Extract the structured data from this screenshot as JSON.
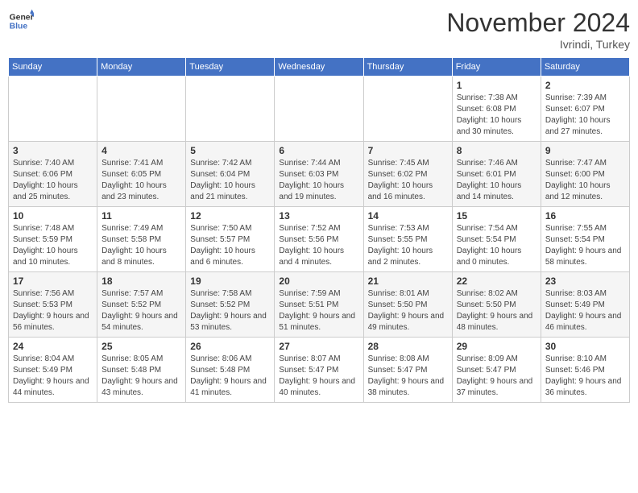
{
  "header": {
    "logo_line1": "General",
    "logo_line2": "Blue",
    "month": "November 2024",
    "location": "Ivrindi, Turkey"
  },
  "weekdays": [
    "Sunday",
    "Monday",
    "Tuesday",
    "Wednesday",
    "Thursday",
    "Friday",
    "Saturday"
  ],
  "weeks": [
    [
      {
        "day": "",
        "info": ""
      },
      {
        "day": "",
        "info": ""
      },
      {
        "day": "",
        "info": ""
      },
      {
        "day": "",
        "info": ""
      },
      {
        "day": "",
        "info": ""
      },
      {
        "day": "1",
        "info": "Sunrise: 7:38 AM\nSunset: 6:08 PM\nDaylight: 10 hours and 30 minutes."
      },
      {
        "day": "2",
        "info": "Sunrise: 7:39 AM\nSunset: 6:07 PM\nDaylight: 10 hours and 27 minutes."
      }
    ],
    [
      {
        "day": "3",
        "info": "Sunrise: 7:40 AM\nSunset: 6:06 PM\nDaylight: 10 hours and 25 minutes."
      },
      {
        "day": "4",
        "info": "Sunrise: 7:41 AM\nSunset: 6:05 PM\nDaylight: 10 hours and 23 minutes."
      },
      {
        "day": "5",
        "info": "Sunrise: 7:42 AM\nSunset: 6:04 PM\nDaylight: 10 hours and 21 minutes."
      },
      {
        "day": "6",
        "info": "Sunrise: 7:44 AM\nSunset: 6:03 PM\nDaylight: 10 hours and 19 minutes."
      },
      {
        "day": "7",
        "info": "Sunrise: 7:45 AM\nSunset: 6:02 PM\nDaylight: 10 hours and 16 minutes."
      },
      {
        "day": "8",
        "info": "Sunrise: 7:46 AM\nSunset: 6:01 PM\nDaylight: 10 hours and 14 minutes."
      },
      {
        "day": "9",
        "info": "Sunrise: 7:47 AM\nSunset: 6:00 PM\nDaylight: 10 hours and 12 minutes."
      }
    ],
    [
      {
        "day": "10",
        "info": "Sunrise: 7:48 AM\nSunset: 5:59 PM\nDaylight: 10 hours and 10 minutes."
      },
      {
        "day": "11",
        "info": "Sunrise: 7:49 AM\nSunset: 5:58 PM\nDaylight: 10 hours and 8 minutes."
      },
      {
        "day": "12",
        "info": "Sunrise: 7:50 AM\nSunset: 5:57 PM\nDaylight: 10 hours and 6 minutes."
      },
      {
        "day": "13",
        "info": "Sunrise: 7:52 AM\nSunset: 5:56 PM\nDaylight: 10 hours and 4 minutes."
      },
      {
        "day": "14",
        "info": "Sunrise: 7:53 AM\nSunset: 5:55 PM\nDaylight: 10 hours and 2 minutes."
      },
      {
        "day": "15",
        "info": "Sunrise: 7:54 AM\nSunset: 5:54 PM\nDaylight: 10 hours and 0 minutes."
      },
      {
        "day": "16",
        "info": "Sunrise: 7:55 AM\nSunset: 5:54 PM\nDaylight: 9 hours and 58 minutes."
      }
    ],
    [
      {
        "day": "17",
        "info": "Sunrise: 7:56 AM\nSunset: 5:53 PM\nDaylight: 9 hours and 56 minutes."
      },
      {
        "day": "18",
        "info": "Sunrise: 7:57 AM\nSunset: 5:52 PM\nDaylight: 9 hours and 54 minutes."
      },
      {
        "day": "19",
        "info": "Sunrise: 7:58 AM\nSunset: 5:52 PM\nDaylight: 9 hours and 53 minutes."
      },
      {
        "day": "20",
        "info": "Sunrise: 7:59 AM\nSunset: 5:51 PM\nDaylight: 9 hours and 51 minutes."
      },
      {
        "day": "21",
        "info": "Sunrise: 8:01 AM\nSunset: 5:50 PM\nDaylight: 9 hours and 49 minutes."
      },
      {
        "day": "22",
        "info": "Sunrise: 8:02 AM\nSunset: 5:50 PM\nDaylight: 9 hours and 48 minutes."
      },
      {
        "day": "23",
        "info": "Sunrise: 8:03 AM\nSunset: 5:49 PM\nDaylight: 9 hours and 46 minutes."
      }
    ],
    [
      {
        "day": "24",
        "info": "Sunrise: 8:04 AM\nSunset: 5:49 PM\nDaylight: 9 hours and 44 minutes."
      },
      {
        "day": "25",
        "info": "Sunrise: 8:05 AM\nSunset: 5:48 PM\nDaylight: 9 hours and 43 minutes."
      },
      {
        "day": "26",
        "info": "Sunrise: 8:06 AM\nSunset: 5:48 PM\nDaylight: 9 hours and 41 minutes."
      },
      {
        "day": "27",
        "info": "Sunrise: 8:07 AM\nSunset: 5:47 PM\nDaylight: 9 hours and 40 minutes."
      },
      {
        "day": "28",
        "info": "Sunrise: 8:08 AM\nSunset: 5:47 PM\nDaylight: 9 hours and 38 minutes."
      },
      {
        "day": "29",
        "info": "Sunrise: 8:09 AM\nSunset: 5:47 PM\nDaylight: 9 hours and 37 minutes."
      },
      {
        "day": "30",
        "info": "Sunrise: 8:10 AM\nSunset: 5:46 PM\nDaylight: 9 hours and 36 minutes."
      }
    ]
  ]
}
